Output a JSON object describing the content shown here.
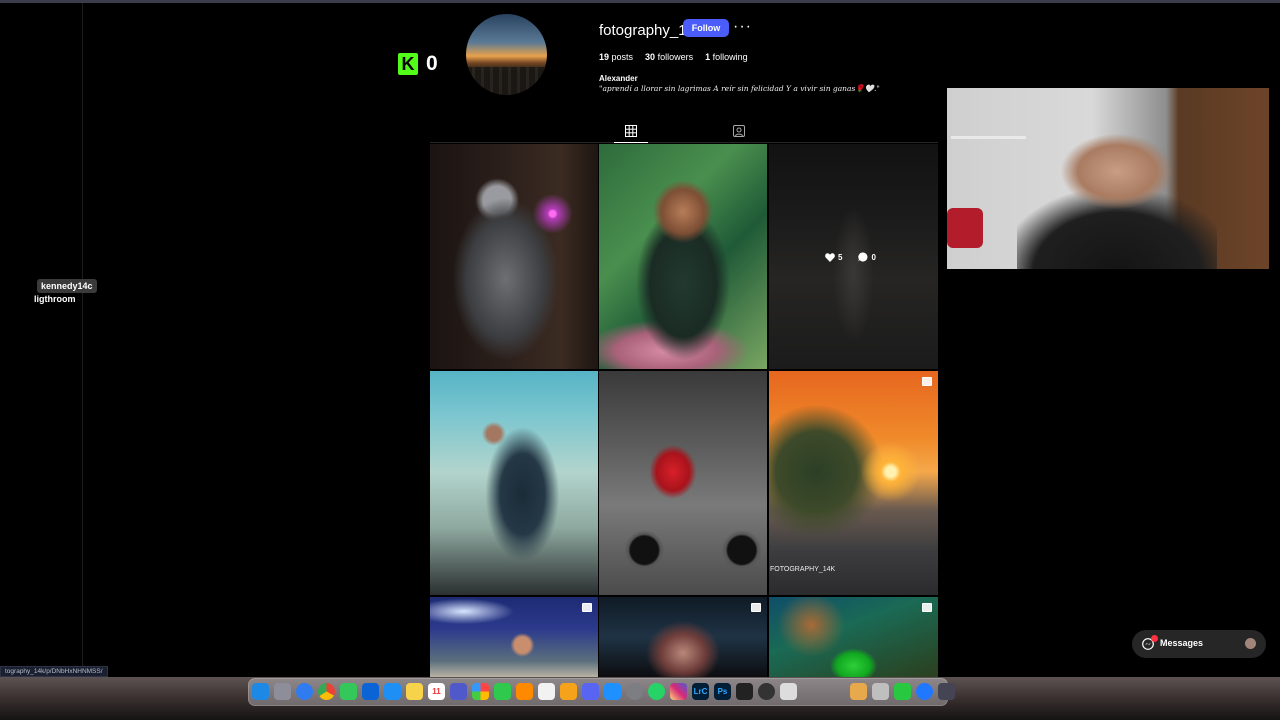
{
  "kick": {
    "count": "0",
    "logo_letter": "K",
    "accent": "#53fc18"
  },
  "profile": {
    "username": "fotography_14k",
    "follow_label": "Follow",
    "more_label": "···",
    "posts_count": "19",
    "posts_label": "posts",
    "followers_count": "30",
    "followers_label": "followers",
    "following_count": "1",
    "following_label": "following",
    "full_name": "Alexander",
    "bio": "\"aprendí a llorar sin lagrimas A reír sin felicidad Y a vivir sin ganas🌹🤍.\""
  },
  "tabs": [
    {
      "name": "posts-grid",
      "icon": "grid-icon",
      "active": true
    },
    {
      "name": "tagged",
      "icon": "tagged-user-icon",
      "active": false
    }
  ],
  "posts": [
    {
      "subject": "welder",
      "multi": false
    },
    {
      "subject": "woman-portrait",
      "multi": false
    },
    {
      "subject": "night-child",
      "multi": false,
      "likes": "5",
      "comments": "0"
    },
    {
      "subject": "man-wetsuit-shore",
      "multi": false
    },
    {
      "subject": "motorcycle-riders",
      "multi": false
    },
    {
      "subject": "sunset-road",
      "multi": true,
      "caption": "FOTOGRAPHY_14K"
    },
    {
      "subject": "night-street-man",
      "multi": true
    },
    {
      "subject": "girl-portrait-night",
      "multi": true
    },
    {
      "subject": "green-parrot",
      "multi": true
    }
  ],
  "overlay": {
    "tag_chip": "kennedy14c",
    "tag_text": "ligthroom",
    "url_status": "tography_14k/p/DNbHxNHNMSS/"
  },
  "messages": {
    "label": "Messages",
    "badge_color": "#ff3040"
  },
  "dock": {
    "icons": [
      "finder-icon",
      "launchpad-icon",
      "safari-icon",
      "chrome-icon",
      "messages-icon",
      "outlook-icon",
      "mail-icon",
      "notes-icon",
      "calendar-icon",
      "teams-icon",
      "photos-icon",
      "facetime-icon",
      "books-icon",
      "textedit-icon",
      "pages-icon",
      "discord-icon",
      "appstore-icon",
      "settings-icon",
      "whatsapp-icon",
      "instagram-icon",
      "lightroom-icon",
      "photoshop-icon",
      "capcut-icon",
      "activity-icon",
      "preview-icon",
      "numbers-icon",
      "quicktime-icon",
      "screen-icon",
      "trash-icon"
    ],
    "lrc_label": "LrC",
    "ps_label": "Ps",
    "calendar_day": "11"
  }
}
